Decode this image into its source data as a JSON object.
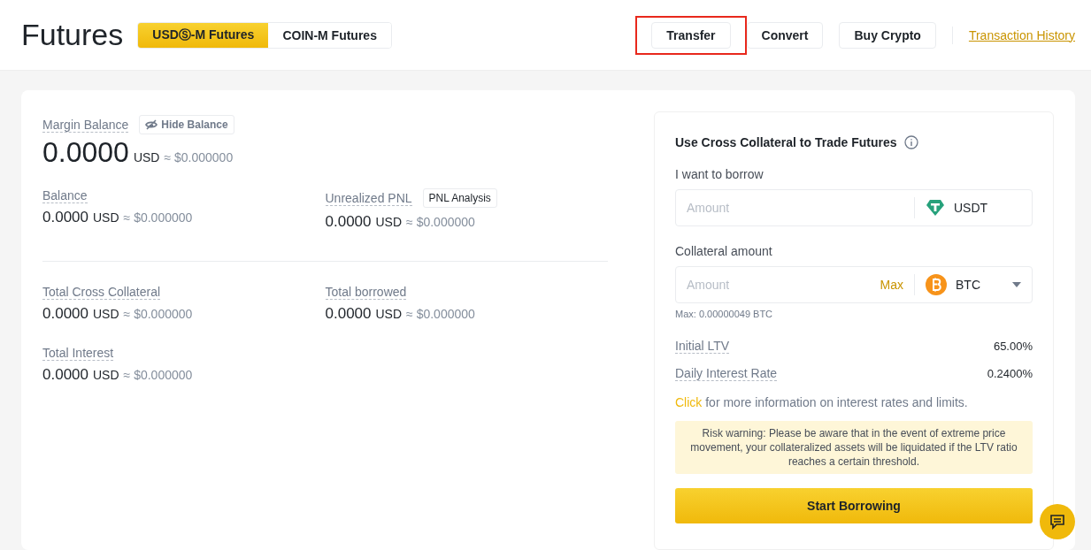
{
  "header": {
    "title": "Futures",
    "tabs": [
      {
        "label": "USDⓈ-M Futures",
        "selected": true
      },
      {
        "label": "COIN-M Futures",
        "selected": false
      }
    ],
    "buttons": [
      {
        "label": "Transfer",
        "highlighted": true
      },
      {
        "label": "Convert",
        "highlighted": false
      },
      {
        "label": "Buy Crypto",
        "highlighted": false
      }
    ],
    "history_link": "Transaction History"
  },
  "margin_balance": {
    "label": "Margin Balance",
    "hide_button": "Hide Balance",
    "value": "0.0000",
    "unit": "USD",
    "approx": "≈ $0.000000"
  },
  "stats": [
    {
      "label": "Balance",
      "value": "0.0000",
      "unit": "USD",
      "approx": "≈ $0.000000"
    },
    {
      "label": "Unrealized PNL",
      "button": "PNL Analysis",
      "value": "0.0000",
      "unit": "USD",
      "approx": "≈ $0.000000"
    },
    {
      "label": "Total Cross Collateral",
      "value": "0.0000",
      "unit": "USD",
      "approx": "≈ $0.000000"
    },
    {
      "label": "Total borrowed",
      "value": "0.0000",
      "unit": "USD",
      "approx": "≈ $0.000000"
    },
    {
      "label": "Total Interest",
      "value": "0.0000",
      "unit": "USD",
      "approx": "≈ $0.000000"
    }
  ],
  "borrow_panel": {
    "title": "Use Cross Collateral to Trade Futures",
    "borrow_label": "I want to borrow",
    "borrow_field": {
      "placeholder": "Amount",
      "coin": "USDT"
    },
    "collateral_label": "Collateral amount",
    "collateral_field": {
      "placeholder": "Amount",
      "max_button": "Max",
      "coin": "BTC"
    },
    "max_note": "Max: 0.00000049 BTC",
    "rows": [
      {
        "label": "Initial LTV",
        "value": "65.00%"
      },
      {
        "label": "Daily Interest Rate",
        "value": "0.2400%"
      }
    ],
    "info": {
      "link": "Click",
      "text": " for more information on interest rates and limits."
    },
    "warning": "Risk warning: Please be aware that in the event of extreme price movement, your collateralized assets will be liquidated if the LTV ratio reaches a certain threshold.",
    "submit": "Start Borrowing"
  }
}
